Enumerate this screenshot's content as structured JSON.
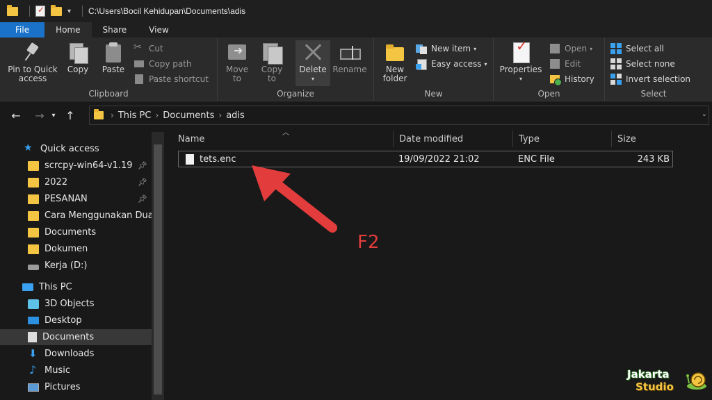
{
  "window": {
    "path": "C:\\Users\\Bocil Kehidupan\\Documents\\adis"
  },
  "tabs": {
    "file": "File",
    "home": "Home",
    "share": "Share",
    "view": "View"
  },
  "ribbon": {
    "clipboard": {
      "label": "Clipboard",
      "pin": "Pin to Quick\naccess",
      "pin_l1": "Pin to Quick",
      "pin_l2": "access",
      "copy": "Copy",
      "paste": "Paste",
      "cut": "Cut",
      "copy_path": "Copy path",
      "paste_shortcut": "Paste shortcut"
    },
    "organize": {
      "label": "Organize",
      "move_l1": "Move",
      "move_l2": "to",
      "copy_l1": "Copy",
      "copy_l2": "to",
      "delete": "Delete",
      "rename": "Rename"
    },
    "new": {
      "label": "New",
      "folder_l1": "New",
      "folder_l2": "folder",
      "new_item": "New item",
      "easy_access": "Easy access"
    },
    "open": {
      "label": "Open",
      "properties": "Properties",
      "open": "Open",
      "edit": "Edit",
      "history": "History"
    },
    "select": {
      "label": "Select",
      "select_all": "Select all",
      "select_none": "Select none",
      "invert": "Invert selection"
    }
  },
  "breadcrumb": [
    "This PC",
    "Documents",
    "adis"
  ],
  "sidebar": {
    "quick_access": "Quick access",
    "items": [
      {
        "label": "scrcpy-win64-v1.19",
        "pinned": true
      },
      {
        "label": "2022",
        "pinned": true
      },
      {
        "label": "PESANAN",
        "pinned": true
      },
      {
        "label": "Cara Menggunakan Dual",
        "pinned": false
      },
      {
        "label": "Documents",
        "pinned": false
      },
      {
        "label": "Dokumen",
        "pinned": false
      },
      {
        "label": "Kerja (D:)",
        "pinned": false
      }
    ],
    "this_pc": "This PC",
    "pc_items": [
      "3D Objects",
      "Desktop",
      "Documents",
      "Downloads",
      "Music",
      "Pictures"
    ]
  },
  "columns": {
    "name": "Name",
    "date": "Date modified",
    "type": "Type",
    "size": "Size"
  },
  "file": {
    "name": "tets.enc",
    "date": "19/09/2022 21:02",
    "type": "ENC File",
    "size": "243 KB"
  },
  "annotation": {
    "text": "F2",
    "color": "#e23c3c"
  },
  "watermark": {
    "line1": "Jakarta",
    "line2": "Studio"
  },
  "colors": {
    "accent": "#1a73c9",
    "background": "#191919",
    "ribbon": "#2b2b2b"
  }
}
